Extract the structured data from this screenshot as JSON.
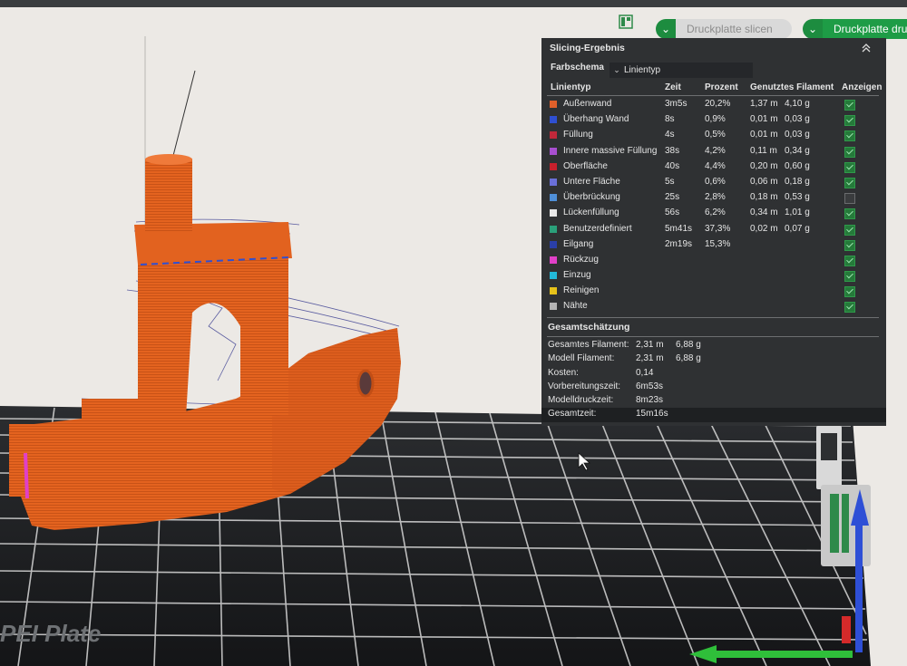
{
  "toolbar": {
    "slice_label": "Druckplatte slicen",
    "print_label": "Druckplatte drucken",
    "colors": {
      "accent": "#1e9c46",
      "disabled": "#d9d9d9"
    }
  },
  "plate": {
    "label": "PEI Plate"
  },
  "panel": {
    "title": "Slicing-Ergebnis",
    "scheme_label": "Farbschema",
    "scheme_value": "Linientyp",
    "columns": {
      "type": "Linientyp",
      "time": "Zeit",
      "percent": "Prozent",
      "filament": "Genutztes Filament",
      "show": "Anzeigen"
    },
    "rows": [
      {
        "label": "Außenwand",
        "color": "#e0602a",
        "time": "3m5s",
        "percent": "20,2%",
        "length": "1,37 m",
        "weight": "4,10 g",
        "show": true
      },
      {
        "label": "Überhang Wand",
        "color": "#2f4fd1",
        "time": "8s",
        "percent": "0,9%",
        "length": "0,01 m",
        "weight": "0,03 g",
        "show": true
      },
      {
        "label": "Füllung",
        "color": "#c0283a",
        "time": "4s",
        "percent": "0,5%",
        "length": "0,01 m",
        "weight": "0,03 g",
        "show": true
      },
      {
        "label": "Innere massive Füllung",
        "color": "#a84fd0",
        "time": "38s",
        "percent": "4,2%",
        "length": "0,11 m",
        "weight": "0,34 g",
        "show": true
      },
      {
        "label": "Oberfläche",
        "color": "#c8202c",
        "time": "40s",
        "percent": "4,4%",
        "length": "0,20 m",
        "weight": "0,60 g",
        "show": true
      },
      {
        "label": "Untere Fläche",
        "color": "#6a6fd8",
        "time": "5s",
        "percent": "0,6%",
        "length": "0,06 m",
        "weight": "0,18 g",
        "show": true
      },
      {
        "label": "Überbrückung",
        "color": "#4f8fd8",
        "time": "25s",
        "percent": "2,8%",
        "length": "0,18 m",
        "weight": "0,53 g",
        "show": false
      },
      {
        "label": "Lückenfüllung",
        "color": "#e8e8e8",
        "time": "56s",
        "percent": "6,2%",
        "length": "0,34 m",
        "weight": "1,01 g",
        "show": true
      },
      {
        "label": "Benutzerdefiniert",
        "color": "#2aa07a",
        "time": "5m41s",
        "percent": "37,3%",
        "length": "0,02 m",
        "weight": "0,07 g",
        "show": true
      },
      {
        "label": "Eilgang",
        "color": "#2a3fa8",
        "time": "2m19s",
        "percent": "15,3%",
        "length": "",
        "weight": "",
        "show": true
      },
      {
        "label": "Rückzug",
        "color": "#e040c8",
        "time": "",
        "percent": "",
        "length": "",
        "weight": "",
        "show": true
      },
      {
        "label": "Einzug",
        "color": "#22b8d8",
        "time": "",
        "percent": "",
        "length": "",
        "weight": "",
        "show": true
      },
      {
        "label": "Reinigen",
        "color": "#e6c21a",
        "time": "",
        "percent": "",
        "length": "",
        "weight": "",
        "show": true
      },
      {
        "label": "Nähte",
        "color": "#b4b4b4",
        "time": "",
        "percent": "",
        "length": "",
        "weight": "",
        "show": true
      }
    ],
    "estimate_title": "Gesamtschätzung",
    "estimates": [
      {
        "key": "Gesamtes Filament:",
        "v1": "2,31 m",
        "v2": "6,88 g"
      },
      {
        "key": "Modell Filament:",
        "v1": "2,31 m",
        "v2": "6,88 g"
      },
      {
        "key": "Kosten:",
        "v1": "0,14",
        "v2": ""
      },
      {
        "key": "Vorbereitungszeit:",
        "v1": "6m53s",
        "v2": ""
      },
      {
        "key": "Modelldruckzeit:",
        "v1": "8m23s",
        "v2": ""
      },
      {
        "key": "Gesamtzeit:",
        "v1": "15m16s",
        "v2": ""
      }
    ]
  }
}
